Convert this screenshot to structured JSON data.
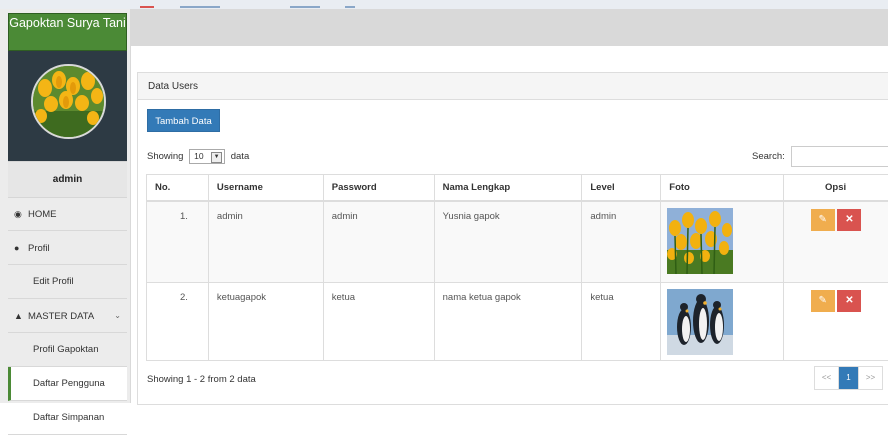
{
  "app": {
    "brand": "Gapoktan Surya Tani",
    "accent": "#4b8a36",
    "primary": "#337ab7"
  },
  "sidebar": {
    "user": "admin",
    "items": [
      {
        "label": "HOME",
        "icon": "dashboard-icon"
      },
      {
        "label": "Profil",
        "icon": "user-icon"
      },
      {
        "label": "Edit Profil",
        "icon": ""
      },
      {
        "label": "MASTER DATA",
        "icon": "sitemap-icon"
      },
      {
        "label": "Profil Gapoktan",
        "icon": ""
      },
      {
        "label": "Daftar Pengguna",
        "icon": "",
        "active": true
      },
      {
        "label": "Daftar Simpanan",
        "icon": ""
      }
    ]
  },
  "panel": {
    "title": "Data Users",
    "add_button": "Tambah Data",
    "length": {
      "prefix": "Showing",
      "value": "10",
      "suffix": "data"
    },
    "search_label": "Search:",
    "search_value": "",
    "info": "Showing 1 - 2 from 2 data",
    "pager": {
      "prev": "<<",
      "page": "1",
      "next": ">>"
    }
  },
  "table": {
    "columns": [
      "No.",
      "Username",
      "Password",
      "Nama Lengkap",
      "Level",
      "Foto",
      "Opsi"
    ],
    "rows": [
      {
        "no": "1.",
        "username": "admin",
        "password": "admin",
        "nama": "Yusnia gapok",
        "level": "admin",
        "foto": "tulips-photo"
      },
      {
        "no": "2.",
        "username": "ketuagapok",
        "password": "ketua",
        "nama": "nama ketua gapok",
        "level": "ketua",
        "foto": "penguins-photo"
      }
    ],
    "actions": {
      "edit_icon": "edit-icon",
      "delete_icon": "close-icon"
    }
  }
}
